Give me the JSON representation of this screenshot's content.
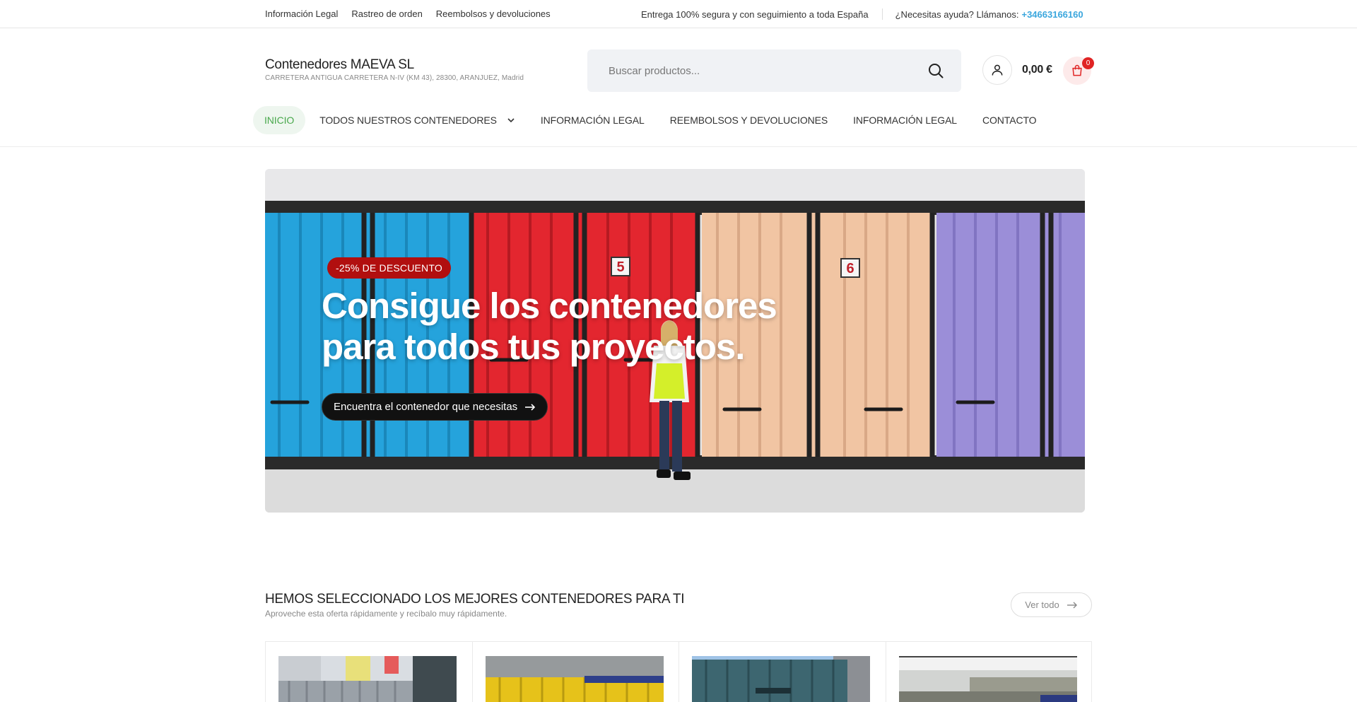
{
  "topbar": {
    "links": [
      "Información Legal",
      "Rastreo de orden",
      "Reembolsos y devoluciones"
    ],
    "shipping_note": "Entrega 100% segura y con seguimiento a toda España",
    "help_text": "¿Necesitas ayuda? Llámanos:",
    "phone": "+34663166160"
  },
  "header": {
    "brand_name": "Contenedores MAEVA SL",
    "brand_address": "CARRETERA ANTIGUA CARRETERA N-IV (KM 43), 28300, ARANJUEZ, Madrid",
    "search_placeholder": "Buscar productos...",
    "cart_total": "0,00 €",
    "cart_count": "0"
  },
  "nav": {
    "items": [
      "Inicio",
      "Todos nuestros contenedores",
      "Información legal",
      "Reembolsos y devoluciones",
      "Información legal",
      "Contacto"
    ],
    "active_index": 0
  },
  "hero": {
    "badge": "-25% DE DESCUENTO",
    "title_line1": "Consigue los contenedores",
    "title_line2": "para todos tus proyectos.",
    "cta_label": "Encuentra el contenedor que necesitas",
    "container_numbers": [
      "5",
      "6"
    ]
  },
  "section": {
    "title": "HEMOS SELECCIONADO LOS MEJORES CONTENEDORES PARA TI",
    "subtitle": "Aproveche esta oferta rápidamente y recíbalo muy rápidamente.",
    "view_all": "Ver todo"
  },
  "colors": {
    "accent_green": "#49a84c",
    "phone_blue": "#3aa6dd",
    "badge_red": "#b10f0f",
    "cart_badge": "#e02424"
  }
}
